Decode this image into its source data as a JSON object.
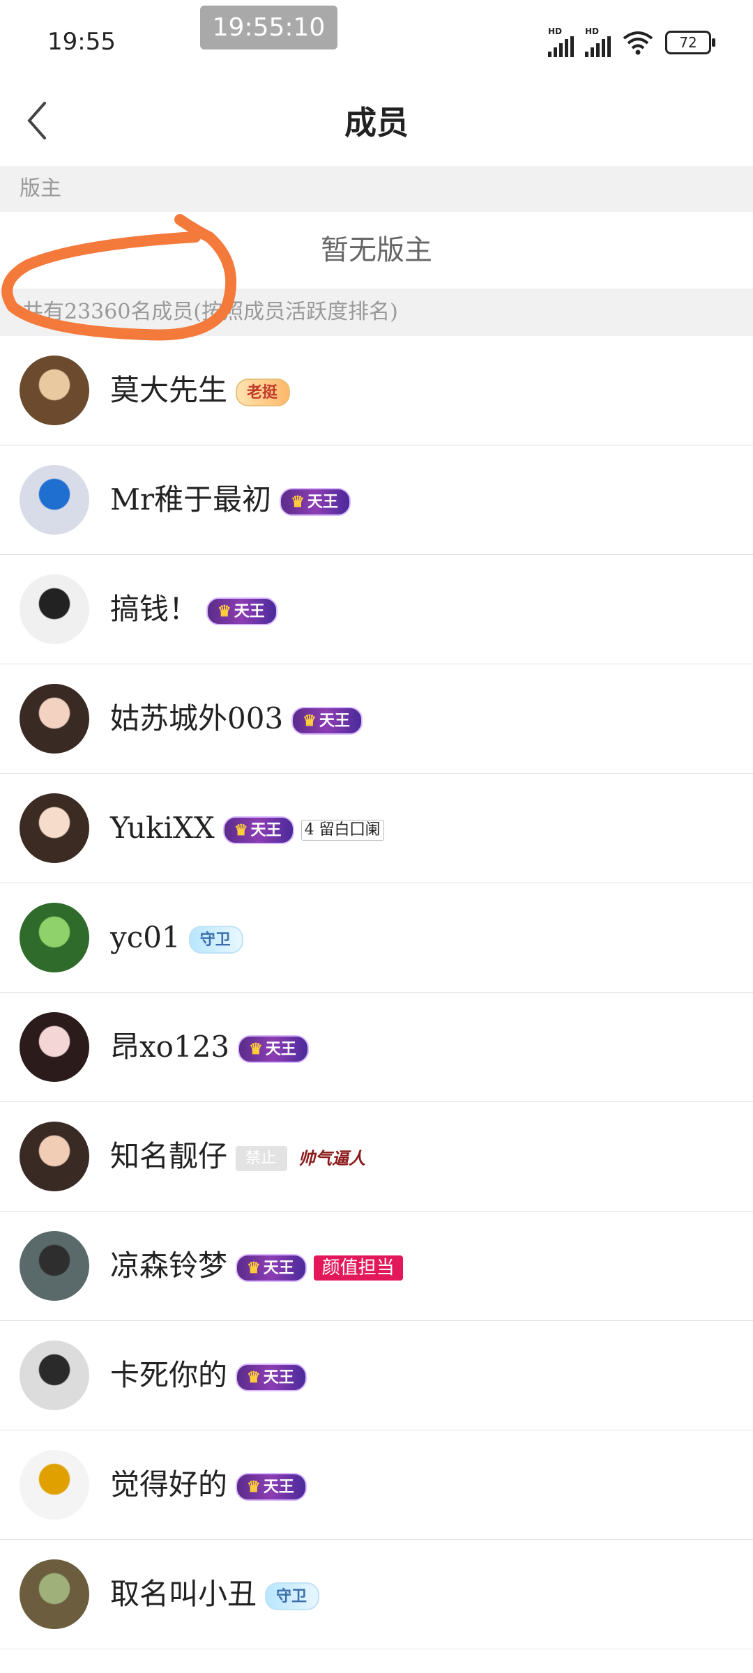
{
  "status_bar": {
    "clock": "19:55",
    "overlay_time": "19:55:10",
    "signal1_label": "HD",
    "signal2_label": "HD",
    "battery": "72"
  },
  "header": {
    "back_icon": "chevron-left-icon",
    "title": "成员"
  },
  "moderator_section": {
    "label": "版主",
    "empty_text": "暂无版主"
  },
  "members_section": {
    "summary": "共有23360名成员(按照成员活跃度排名)"
  },
  "members": [
    {
      "name": "莫大先生",
      "badges": [
        {
          "type": "laoting",
          "text": "老挺"
        }
      ]
    },
    {
      "name": "Mr稚于最初",
      "badges": [
        {
          "type": "tianwang",
          "text": "天王"
        }
      ]
    },
    {
      "name": "搞钱！",
      "badges": [
        {
          "type": "tianwang",
          "text": "天王"
        }
      ]
    },
    {
      "name": "姑苏城外003",
      "badges": [
        {
          "type": "tianwang",
          "text": "天王"
        }
      ]
    },
    {
      "name": "YukiXX",
      "badges": [
        {
          "type": "tianwang",
          "text": "天王"
        },
        {
          "type": "level",
          "text": "4 留白囗阑"
        }
      ]
    },
    {
      "name": "yc01",
      "badges": [
        {
          "type": "shouwei",
          "text": "守卫"
        }
      ]
    },
    {
      "name": "昂xo123",
      "badges": [
        {
          "type": "tianwang",
          "text": "天王"
        }
      ]
    },
    {
      "name": "知名靓仔",
      "badges": [
        {
          "type": "ban",
          "text": "禁止"
        },
        {
          "type": "shuai",
          "text": "帅气逼人"
        }
      ]
    },
    {
      "name": "凉森铃梦",
      "badges": [
        {
          "type": "tianwang",
          "text": "天王"
        },
        {
          "type": "yanzhi",
          "text": "颜值担当"
        }
      ]
    },
    {
      "name": "卡死你的",
      "badges": [
        {
          "type": "tianwang",
          "text": "天王"
        }
      ]
    },
    {
      "name": "觉得好的",
      "badges": [
        {
          "type": "tianwang",
          "text": "天王"
        }
      ]
    },
    {
      "name": "取名叫小丑",
      "badges": [
        {
          "type": "shouwei",
          "text": "守卫"
        }
      ]
    }
  ],
  "colors": {
    "section_bg": "#f1f1f1",
    "annotation_circle": "#f47a3c",
    "yanzhi_badge": "#e2185b"
  }
}
